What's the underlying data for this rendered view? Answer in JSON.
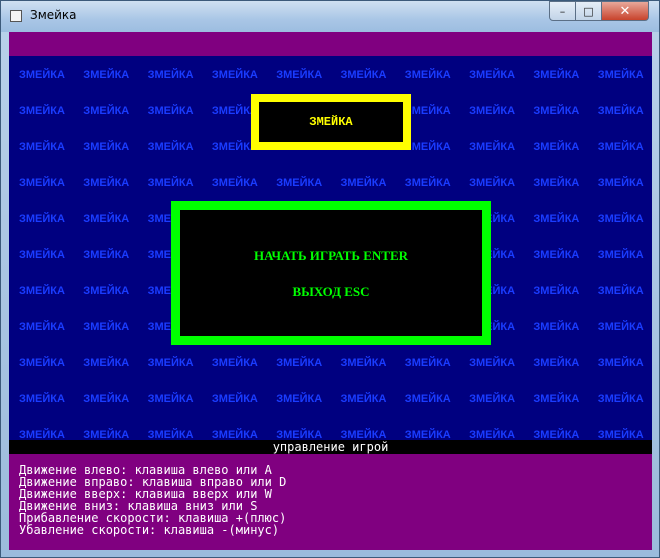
{
  "window": {
    "title": "Змейка",
    "minimize_glyph": "–",
    "maximize_glyph": "□",
    "close_glyph": "✕"
  },
  "pattern": {
    "word": "ЗМЕЙКА"
  },
  "title_box": {
    "label": "ЗМЕЙКА"
  },
  "menu": {
    "start_label": "НАЧАТЬ ИГРАТЬ ENTER",
    "exit_label": "ВЫХОД ESC"
  },
  "controls": {
    "header": "управление игрой",
    "lines": [
      "Движение влево: клавиша влево или A",
      "Движение вправо: клавиша вправо или D",
      "Движение вверх: клавиша вверх или W",
      "Движение вниз: клавиша вниз или S",
      "Прибавление скорости: клавиша +(плюс)",
      "Убавление скорости: клавиша -(минус)"
    ]
  },
  "colors": {
    "background": "#000080",
    "banner": "#800080",
    "title_border": "#ffff00",
    "menu_border": "#00ff00",
    "pattern_text": "#1a3cff",
    "controls_text": "#ffffff"
  }
}
